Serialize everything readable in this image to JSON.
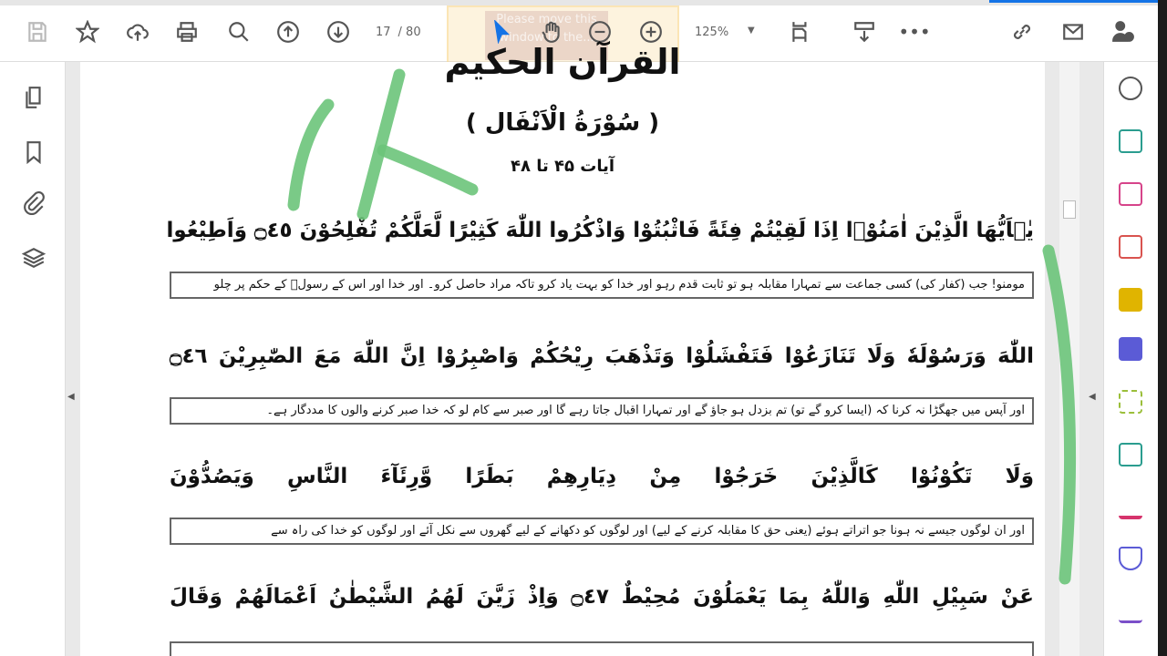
{
  "toolbar": {
    "page_current": "17",
    "page_total": "/ 80",
    "zoom": "125%",
    "overlay_text": "Please move this window to the..."
  },
  "document": {
    "surah_header_top": "القرآن الحکیم",
    "surah_name": "( سُوْرَةُ الْاَنْفَال )",
    "ayat_range": "آیات ۴۵ تا ۴۸",
    "ayat": [
      "يٰۤاَيُّهَا الَّذِيْنَ اٰمَنُوْۤا اِذَا لَقِيْتُمْ فِئَةً فَاثْبُتُوْا وَاذْكُرُوا اللّٰهَ كَثِيْرًا لَّعَلَّكُمْ تُفْلِحُوْنَ ۝٤٥ وَاَطِيْعُوا",
      "اللّٰهَ وَرَسُوْلَهٗ وَلَا تَنَازَعُوْا فَتَفْشَلُوْا وَتَذْهَبَ رِيْحُكُمْ وَاصْبِرُوْا اِنَّ اللّٰهَ مَعَ الصّٰبِرِيْنَ ۝٤٦",
      "وَلَا تَكُوْنُوْا كَالَّذِيْنَ خَرَجُوْا مِنْ دِيَارِهِمْ بَطَرًا وَّرِئَآءَ النَّاسِ وَيَصُدُّوْنَ",
      "عَنْ سَبِيْلِ اللّٰهِ وَاللّٰهُ بِمَا يَعْمَلُوْنَ مُحِيْطٌ ۝٤٧ وَاِذْ زَيَّنَ لَهُمُ الشَّيْطٰنُ اَعْمَالَهُمْ وَقَالَ"
    ],
    "translations": [
      "مومنو! جب (کفار کی) کسی جماعت سے تمہارا مقابلہ ہو تو ثابت قدم رہو اور خدا کو بہت یاد کرو تاکہ مراد حاصل کرو۔ اور خدا اور اس کے رسولؐ کے حکم پر چلو",
      "اور آپس میں جھگڑا نہ کرنا کہ (ایسا کرو گے تو) تم بزدل ہو جاؤ گے اور تمہارا اقبال جاتا رہے گا اور صبر سے کام لو کہ خدا صبر کرنے والوں کا مددگار ہے۔",
      "اور ان لوگوں جیسے نہ ہونا جو اتراتے ہوئے (یعنی حق کا مقابلہ کرنے کے لیے) اور لوگوں کو دکھانے کے لیے گھروں سے نکل آئے اور لوگوں کو خدا کی راہ سے"
    ]
  },
  "colors": {
    "ink": "#6cc47a",
    "accent": "#1473e6"
  }
}
